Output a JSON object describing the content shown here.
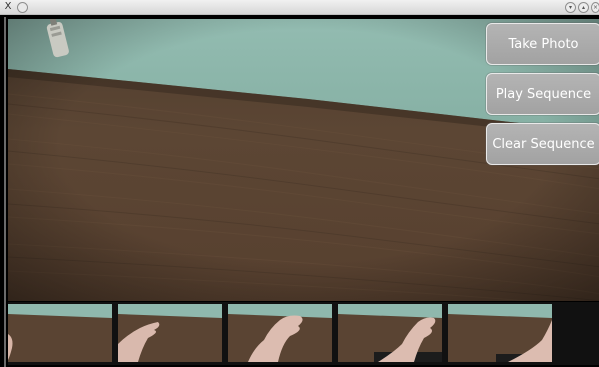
{
  "window": {
    "title_icon": "X",
    "menu_icon": "window-menu-icon",
    "controls": [
      "minimize-icon",
      "maximize-icon",
      "close-icon"
    ]
  },
  "buttons": {
    "take_photo": "Take Photo",
    "play_sequence": "Play Sequence",
    "clear_sequence": "Clear Sequence"
  },
  "sequence": {
    "thumbnail_count": 5,
    "thumbnails": [
      {
        "name": "sequence-thumb-1",
        "subject": "hand-edge"
      },
      {
        "name": "sequence-thumb-2",
        "subject": "hand-open"
      },
      {
        "name": "sequence-thumb-3",
        "subject": "hand-open"
      },
      {
        "name": "sequence-thumb-4",
        "subject": "hand-open"
      },
      {
        "name": "sequence-thumb-5",
        "subject": "hand-partial"
      }
    ]
  },
  "colors": {
    "button_bg": "#a9a9a9",
    "wall": "#8fb8ad",
    "wood": "#5a4433"
  }
}
